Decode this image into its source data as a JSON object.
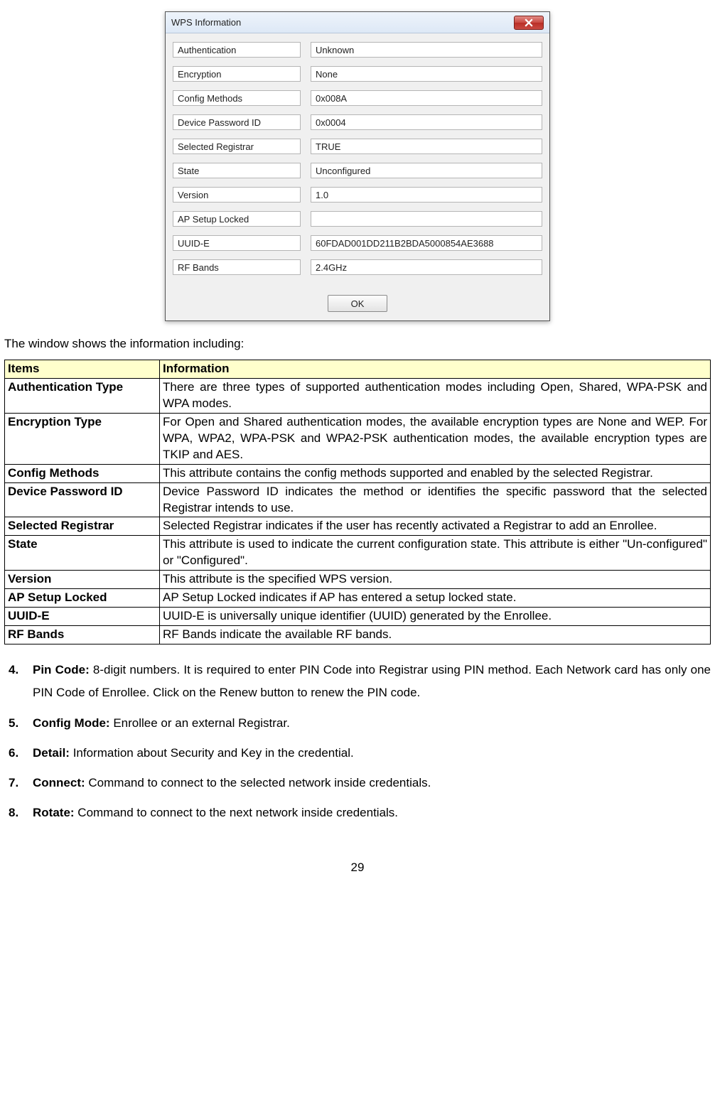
{
  "dialog": {
    "title": "WPS Information",
    "close_icon": "close",
    "ok_label": "OK",
    "fields": [
      {
        "label": "Authentication",
        "value": "Unknown"
      },
      {
        "label": "Encryption",
        "value": "None"
      },
      {
        "label": "Config Methods",
        "value": "0x008A"
      },
      {
        "label": "Device Password ID",
        "value": "0x0004"
      },
      {
        "label": "Selected Registrar",
        "value": "TRUE"
      },
      {
        "label": "State",
        "value": "Unconfigured"
      },
      {
        "label": "Version",
        "value": "1.0"
      },
      {
        "label": "AP Setup Locked",
        "value": ""
      },
      {
        "label": "UUID-E",
        "value": "60FDAD001DD211B2BDA5000854AE3688"
      },
      {
        "label": "RF Bands",
        "value": "2.4GHz"
      }
    ]
  },
  "intro": "The window shows the information including:",
  "table": {
    "headers": {
      "items": "Items",
      "info": "Information"
    },
    "rows": [
      {
        "item": "Authentication Type",
        "info": "There are three types of supported authentication modes including Open, Shared, WPA-PSK and WPA modes."
      },
      {
        "item": "Encryption Type",
        "info": "For Open and Shared authentication modes, the available encryption types are None and WEP. For WPA, WPA2, WPA-PSK and WPA2-PSK authentication modes, the available encryption types are TKIP and AES."
      },
      {
        "item": "Config Methods",
        "info": "This attribute contains the config methods supported and enabled by the selected Registrar."
      },
      {
        "item": "Device Password ID",
        "info": "Device Password ID indicates the method or identifies the specific password that the selected Registrar intends to use."
      },
      {
        "item": "Selected Registrar",
        "info": "Selected Registrar indicates if the user has recently activated a Registrar to add an Enrollee."
      },
      {
        "item": "State",
        "info": "This attribute is used to indicate the current configuration state. This attribute is either \"Un-configured\" or \"Configured\"."
      },
      {
        "item": "Version",
        "info": "This attribute is the specified WPS version."
      },
      {
        "item": "AP Setup Locked",
        "info": "AP Setup Locked indicates if AP has entered a setup locked state."
      },
      {
        "item": "UUID-E",
        "info": "UUID-E is universally unique identifier (UUID) generated by the Enrollee."
      },
      {
        "item": "RF Bands",
        "info": "RF Bands indicate the available RF bands."
      }
    ]
  },
  "list": [
    {
      "title": "Pin Code:",
      "body": " 8-digit numbers. It is required to enter PIN Code into Registrar using PIN method. Each Network card has only one PIN Code of Enrollee. Click on the Renew button to renew the PIN code."
    },
    {
      "title": "Config Mode:",
      "body": " Enrollee or an external Registrar."
    },
    {
      "title": "Detail:",
      "body": " Information about Security and Key in the credential."
    },
    {
      "title": "Connect:",
      "body": " Command to connect to the selected network inside credentials."
    },
    {
      "title": "Rotate:",
      "body": " Command to connect to the next network inside credentials."
    }
  ],
  "page_number": "29"
}
